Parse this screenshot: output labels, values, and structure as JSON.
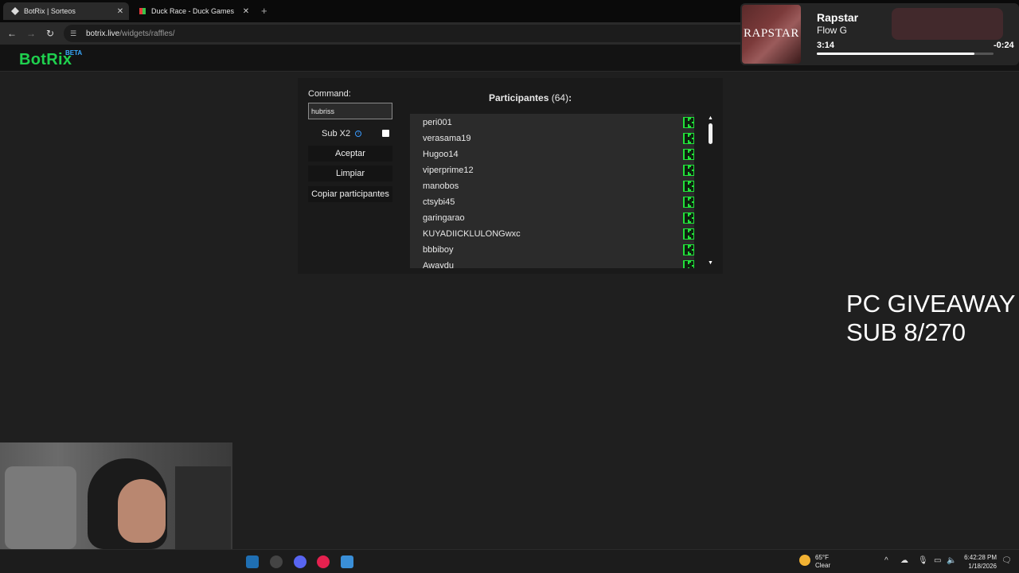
{
  "browser": {
    "tabs": [
      {
        "label": "BotRix | Sorteos",
        "active": true
      },
      {
        "label": "Duck Race - Duck Games",
        "active": false
      }
    ],
    "url_host": "botrix.live",
    "url_path": "/widgets/raffles/"
  },
  "site": {
    "logo": "BotRix",
    "beta": "BETA"
  },
  "panel": {
    "command_label": "Command:",
    "command_value": "hubriss",
    "sub_label": "Sub X2",
    "accept_label": "Aceptar",
    "clear_label": "Limpiar",
    "copy_label": "Copiar participantes",
    "participants_title": "Participantes",
    "participants_count": "(64)",
    "participants_colon": ":",
    "participants": [
      "peri001",
      "verasama19",
      "Hugoo14",
      "viperprime12",
      "manobos",
      "ctsybi45",
      "garingarao",
      "KUYADIICKLULONGwxc",
      "bbbiboy",
      "Awaydu"
    ]
  },
  "media": {
    "album_text": "RAPSTAR",
    "song": "Rapstar",
    "artist": "Flow G",
    "elapsed": "3:14",
    "remaining": "-0:24",
    "progress": 0.89
  },
  "overlay": {
    "line1": "PC GIVEAWAY",
    "line2": "SUB 8/270"
  },
  "taskbar": {
    "temp": "65°F",
    "condition": "Clear",
    "time": "6:42:28 PM",
    "date": "1/18/2026"
  },
  "colors": {
    "brand_green": "#1fd04e",
    "kick_green": "#22e33a",
    "beta_blue": "#39a9ff"
  }
}
